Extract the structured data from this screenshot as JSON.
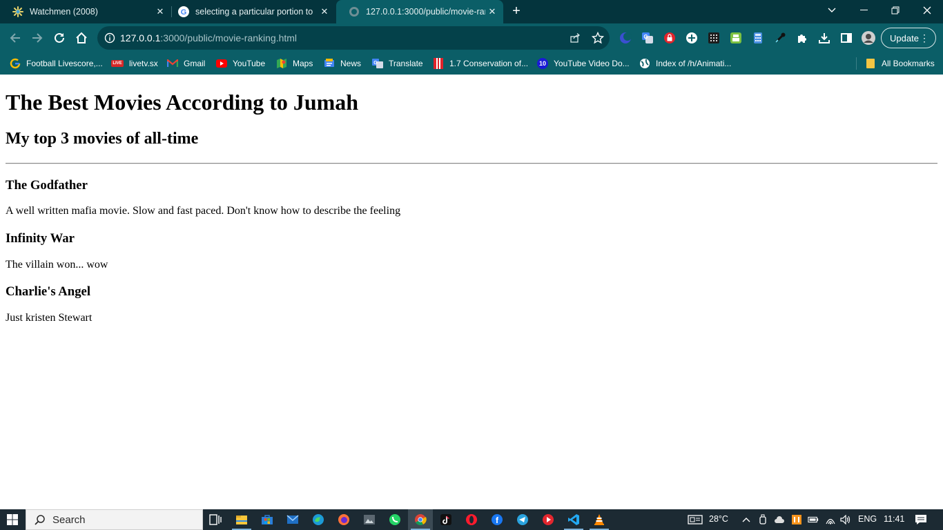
{
  "browser": {
    "tabs": [
      {
        "title": "Watchmen (2008)",
        "icon": "watchmen-favicon",
        "active": false
      },
      {
        "title": "selecting a particular portion to",
        "icon": "google-favicon",
        "active": false
      },
      {
        "title": "127.0.0.1:3000/public/movie-ran",
        "icon": "globe-favicon",
        "active": true
      }
    ],
    "address": {
      "host": "127.0.0.1",
      "path": ":3000/public/movie-ranking.html"
    },
    "update_label": "Update",
    "bookmarks": [
      {
        "label": "Football Livescore,...",
        "icon": "google-g-icon"
      },
      {
        "label": "livetv.sx",
        "icon": "live-icon"
      },
      {
        "label": "Gmail",
        "icon": "gmail-icon"
      },
      {
        "label": "YouTube",
        "icon": "youtube-icon"
      },
      {
        "label": "Maps",
        "icon": "maps-icon"
      },
      {
        "label": "News",
        "icon": "news-icon"
      },
      {
        "label": "Translate",
        "icon": "translate-icon"
      },
      {
        "label": "1.7 Conservation of...",
        "icon": "bookmark-red-icon"
      },
      {
        "label": "YouTube Video Do...",
        "icon": "number-ten-icon"
      },
      {
        "label": "Index of /h/Animati...",
        "icon": "globe-icon"
      }
    ],
    "all_bookmarks_label": "All Bookmarks"
  },
  "page": {
    "title": "The Best Movies According to Jumah",
    "subtitle": "My top 3 movies of all-time",
    "movies": [
      {
        "name": "The Godfather",
        "description": "A well written mafia movie. Slow and fast paced. Don't know how to describe the feeling"
      },
      {
        "name": "Infinity War",
        "description": "The villain won... wow"
      },
      {
        "name": "Charlie's Angel",
        "description": "Just kristen Stewart"
      }
    ]
  },
  "taskbar": {
    "search_placeholder": "Search",
    "weather": "28°C",
    "language": "ENG",
    "time": "11:41"
  },
  "colors": {
    "tabstrip": "#04343d",
    "toolbar": "#0b5e67",
    "omnibox": "#04414a",
    "taskbar": "#1c2a33"
  }
}
